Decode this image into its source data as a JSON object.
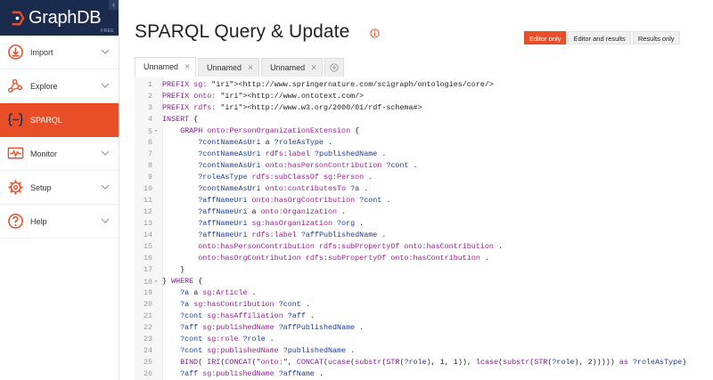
{
  "app": {
    "brand": "GraphDB",
    "edition": "FREE",
    "collapse_glyph": "‹",
    "colors": {
      "brand_bg": "#1b2b4d",
      "accent": "#e84e27",
      "keyword": "#7a1f8c",
      "prefix": "#9b2193",
      "variable": "#1b3d8f",
      "iri": "#2b7a1f"
    }
  },
  "sidebar": {
    "items": [
      {
        "label": "Import",
        "icon": "import-icon"
      },
      {
        "label": "Explore",
        "icon": "explore-icon"
      },
      {
        "label": "SPARQL",
        "icon": "sparql-icon",
        "active": true
      },
      {
        "label": "Monitor",
        "icon": "monitor-icon"
      },
      {
        "label": "Setup",
        "icon": "setup-icon"
      },
      {
        "label": "Help",
        "icon": "help-icon"
      }
    ]
  },
  "page": {
    "title": "SPARQL Query & Update",
    "info_icon": "info-icon",
    "modes": [
      {
        "label": "Editor only",
        "active": true
      },
      {
        "label": "Editor and results",
        "active": false
      },
      {
        "label": "Results only",
        "active": false
      }
    ]
  },
  "tabs": [
    {
      "label": "Unnamed",
      "active": true
    },
    {
      "label": "Unnamed",
      "active": false
    },
    {
      "label": "Unnamed",
      "active": false
    }
  ],
  "editor": {
    "lines": [
      {
        "n": "1",
        "fold": "",
        "text": "PREFIX sg: <http://www.springernature.com/scigraph/ontologies/core/>"
      },
      {
        "n": "2",
        "fold": "",
        "text": "PREFIX onto: <http://www.ontotext.com/>"
      },
      {
        "n": "3",
        "fold": "",
        "text": "PREFIX rdfs: <http://www.w3.org/2000/01/rdf-schema#>"
      },
      {
        "n": "4",
        "fold": "",
        "text": "INSERT {"
      },
      {
        "n": "5",
        "fold": "▾",
        "text": "    GRAPH onto:PersonOrganizationExtension {"
      },
      {
        "n": "6",
        "fold": "",
        "text": "        ?contNameAsUri a ?roleAsType ."
      },
      {
        "n": "7",
        "fold": "",
        "text": "        ?contNameAsUri rdfs:label ?publishedName ."
      },
      {
        "n": "8",
        "fold": "",
        "text": "        ?contNameAsUri onto:hasPersonContribution ?cont ."
      },
      {
        "n": "9",
        "fold": "",
        "text": "        ?roleAsType rdfs:subClassOf sg:Person ."
      },
      {
        "n": "10",
        "fold": "",
        "text": "        ?contNameAsUri onto:contributesTo ?a ."
      },
      {
        "n": "11",
        "fold": "",
        "text": "        ?affNameUri onto:hasOrgContribution ?cont ."
      },
      {
        "n": "12",
        "fold": "",
        "text": "        ?affNameUri a onto:Organization ."
      },
      {
        "n": "13",
        "fold": "",
        "text": "        ?affNameUri sg:hasOrganization ?org ."
      },
      {
        "n": "14",
        "fold": "",
        "text": "        ?affNameUri rdfs:label ?affPublishedName ."
      },
      {
        "n": "15",
        "fold": "",
        "text": "        onto:hasPersonContribution rdfs:subPropertyOf onto:hasContribution ."
      },
      {
        "n": "16",
        "fold": "",
        "text": "        onto:hasOrgContribution rdfs:subPropertyOf onto:hasContribution ."
      },
      {
        "n": "17",
        "fold": "",
        "text": "    }"
      },
      {
        "n": "18",
        "fold": "▾",
        "text": "} WHERE {"
      },
      {
        "n": "19",
        "fold": "",
        "text": "    ?a a sg:Article ."
      },
      {
        "n": "20",
        "fold": "",
        "text": "    ?a sg:hasContribution ?cont ."
      },
      {
        "n": "21",
        "fold": "",
        "text": "    ?cont sg:hasAffiliation ?aff ."
      },
      {
        "n": "22",
        "fold": "",
        "text": "    ?aff sg:publishedName ?affPublishedName ."
      },
      {
        "n": "23",
        "fold": "",
        "text": "    ?cont sg:role ?role ."
      },
      {
        "n": "24",
        "fold": "",
        "text": "    ?cont sg:publishedName ?publishedName ."
      },
      {
        "n": "25",
        "fold": "",
        "text": "    BIND( IRI(CONCAT(\"onto:\", CONCAT(ucase(substr(STR(?role), 1, 1)), lcase(substr(STR(?role), 2))))) as ?roleAsType)"
      },
      {
        "n": "26",
        "fold": "",
        "text": "    ?aff sg:publishedName ?affName ."
      }
    ]
  }
}
